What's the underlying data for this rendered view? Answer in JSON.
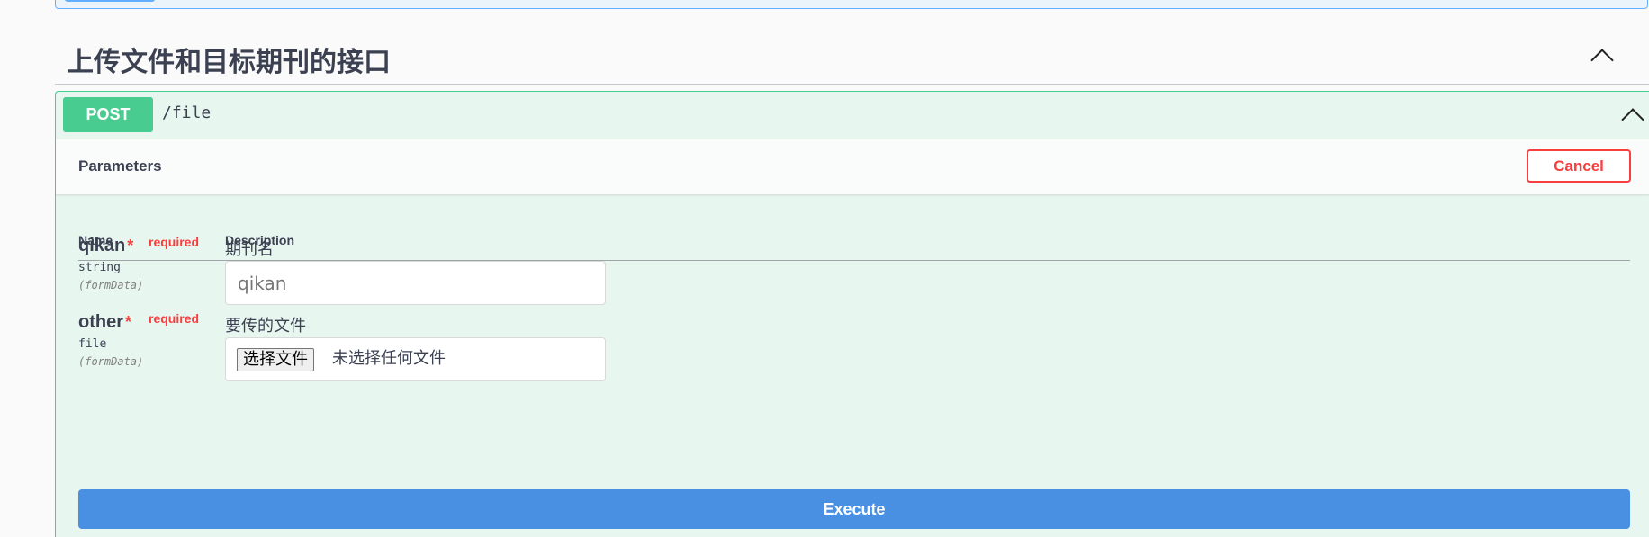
{
  "section": {
    "title": "上传文件和目标期刊的接口"
  },
  "operation": {
    "method": "POST",
    "path": "/file",
    "method_color": "#49cc90"
  },
  "parameters": {
    "title": "Parameters",
    "cancel_label": "Cancel",
    "columns": {
      "name": "Name",
      "description": "Description"
    },
    "items": [
      {
        "name": "qikan",
        "required_star": "*",
        "required_label": "required",
        "type": "string",
        "in": "(formData)",
        "description": "期刊名",
        "placeholder": "qikan"
      },
      {
        "name": "other",
        "required_star": "*",
        "required_label": "required",
        "type": "file",
        "in": "(formData)",
        "description": "要传的文件",
        "file_button": "选择文件",
        "file_status": "未选择任何文件"
      }
    ]
  },
  "execute_label": "Execute",
  "colors": {
    "cancel": "#f93e3e",
    "execute": "#4990e2",
    "required": "#f93e3e"
  },
  "icons": {
    "tag_toggle": "chevron-up-icon",
    "op_toggle": "chevron-up-icon"
  }
}
